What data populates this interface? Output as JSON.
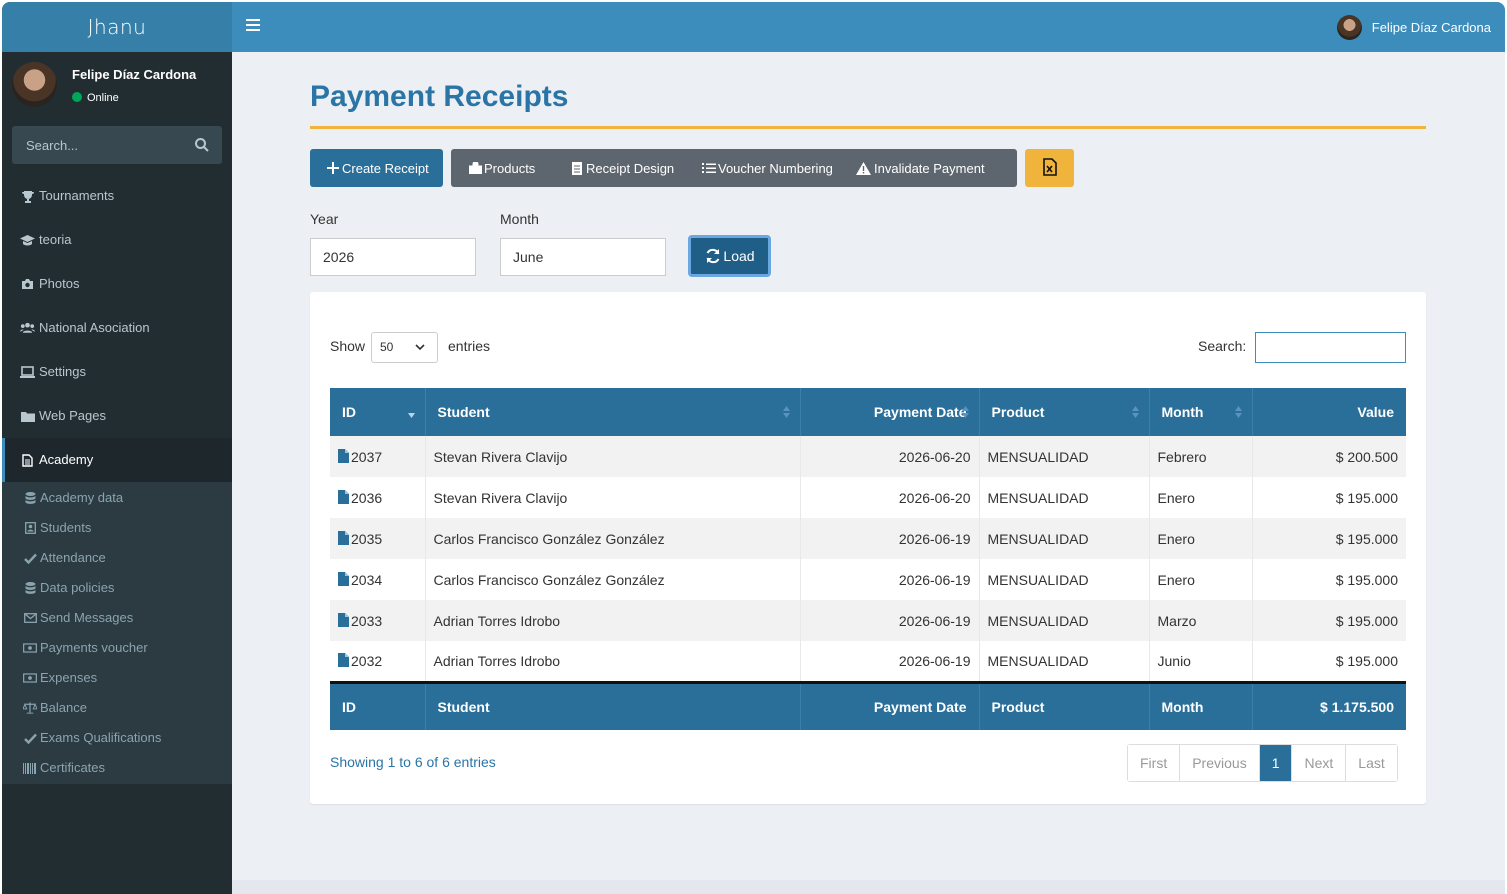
{
  "sidebar": {
    "brand": "Jhanu",
    "user_name": "Felipe Díaz Cardona",
    "user_status": "Online",
    "search_placeholder": "Search...",
    "menu": [
      {
        "label": "Tournaments",
        "icon": "trophy-icon"
      },
      {
        "label": "teoria",
        "icon": "graduation-cap-icon"
      },
      {
        "label": "Photos",
        "icon": "camera-icon"
      },
      {
        "label": "National Asociation",
        "icon": "users-icon"
      },
      {
        "label": "Settings",
        "icon": "laptop-icon"
      },
      {
        "label": "Web Pages",
        "icon": "folder-icon"
      },
      {
        "label": "Academy",
        "icon": "file-icon"
      }
    ],
    "submenu": [
      {
        "label": "Academy data",
        "icon": "database-icon"
      },
      {
        "label": "Students",
        "icon": "id-card-icon"
      },
      {
        "label": "Attendance",
        "icon": "check-icon"
      },
      {
        "label": "Data policies",
        "icon": "database-icon"
      },
      {
        "label": "Send Messages",
        "icon": "envelope-icon"
      },
      {
        "label": "Payments voucher",
        "icon": "money-icon"
      },
      {
        "label": "Expenses",
        "icon": "money-icon"
      },
      {
        "label": "Balance",
        "icon": "balance-scale-icon"
      },
      {
        "label": "Exams Qualifications",
        "icon": "check-icon"
      },
      {
        "label": "Certificates",
        "icon": "barcode-icon"
      }
    ]
  },
  "header": {
    "user_name": "Felipe Díaz Cardona"
  },
  "page": {
    "title": "Payment Receipts",
    "buttons": {
      "create": "Create Receipt",
      "products": "Products",
      "receipt_design": "Receipt Design",
      "voucher_numbering": "Voucher Numbering",
      "invalidate": "Invalidate Payment"
    },
    "filters": {
      "year_label": "Year",
      "year_value": "2026",
      "month_label": "Month",
      "month_value": "June",
      "load_label": "Load"
    }
  },
  "table": {
    "show_label": "Show",
    "page_size": "50",
    "entries_label": "entries",
    "search_label": "Search:",
    "columns": [
      "ID",
      "Student",
      "Payment Date",
      "Product",
      "Month",
      "Value"
    ],
    "rows": [
      [
        "2037",
        "Stevan Rivera Clavijo",
        "2026-06-20",
        "MENSUALIDAD",
        "Febrero",
        "$ 200.500"
      ],
      [
        "2036",
        "Stevan Rivera Clavijo",
        "2026-06-20",
        "MENSUALIDAD",
        "Enero",
        "$ 195.000"
      ],
      [
        "2035",
        "Carlos Francisco González González",
        "2026-06-19",
        "MENSUALIDAD",
        "Enero",
        "$ 195.000"
      ],
      [
        "2034",
        "Carlos Francisco González González",
        "2026-06-19",
        "MENSUALIDAD",
        "Enero",
        "$ 195.000"
      ],
      [
        "2033",
        "Adrian Torres Idrobo",
        "2026-06-19",
        "MENSUALIDAD",
        "Marzo",
        "$ 195.000"
      ],
      [
        "2032",
        "Adrian Torres Idrobo",
        "2026-06-19",
        "MENSUALIDAD",
        "Junio",
        "$ 195.000"
      ]
    ],
    "footer": [
      "ID",
      "Student",
      "Payment Date",
      "Product",
      "Month",
      "$ 1.175.500"
    ],
    "info": "Showing 1 to 6 of 6 entries",
    "pagination": [
      "First",
      "Previous",
      "1",
      "Next",
      "Last"
    ]
  },
  "colors": {
    "header_bg": "#3c8dbc",
    "sidebar_bg": "#222d32",
    "table_header": "#2a6f9a",
    "accent_line": "#f0b43c"
  }
}
